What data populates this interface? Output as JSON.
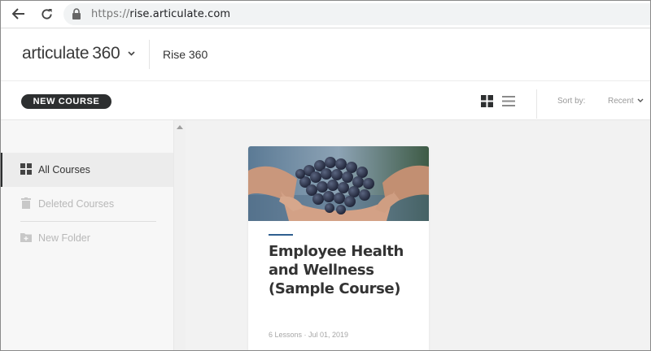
{
  "browser": {
    "url_scheme": "https://",
    "url_host": "rise.articulate.com"
  },
  "header": {
    "logo_text": "articulate",
    "logo_number": "360",
    "product_title": "Rise 360"
  },
  "toolbar": {
    "new_course_label": "NEW COURSE",
    "sort_label": "Sort by:",
    "sort_value": "Recent"
  },
  "sidebar": {
    "items": [
      {
        "label": "All Courses",
        "icon": "grid-icon",
        "active": true
      },
      {
        "label": "Deleted Courses",
        "icon": "trash-icon",
        "active": false
      },
      {
        "label": "New Folder",
        "icon": "folder-plus-icon",
        "active": false
      }
    ]
  },
  "courses": [
    {
      "title": "Employee Health and Wellness (Sample Course)",
      "meta": "6 Lessons · Jul 01, 2019",
      "image": "hands-holding-grapes"
    }
  ],
  "colors": {
    "button_dark": "#2d2f30",
    "accent_blue": "#2f5f8f",
    "sidebar_bg": "#f7f7f7",
    "main_bg": "#f2f2f2"
  }
}
